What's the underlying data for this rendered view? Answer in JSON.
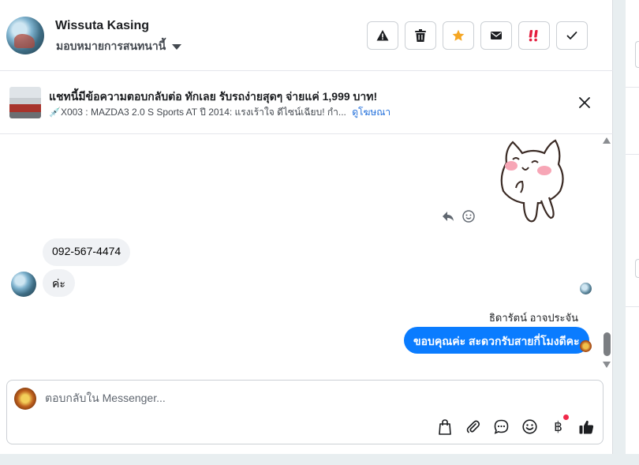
{
  "header": {
    "contact_name": "Wissuta Kasing",
    "assign_label": "มอบหมายการสนทนานี้"
  },
  "toolbar": {
    "buttons": [
      {
        "name": "report-spam-button",
        "icon": "warning-icon"
      },
      {
        "name": "delete-button",
        "icon": "trash-icon"
      },
      {
        "name": "star-button",
        "icon": "star-icon",
        "color": "#f5a623"
      },
      {
        "name": "mark-unread-button",
        "icon": "envelope-icon"
      },
      {
        "name": "follow-up-button",
        "icon": "exclamation-icon",
        "color": "#e41e3f"
      },
      {
        "name": "mark-done-button",
        "icon": "check-icon"
      }
    ]
  },
  "ad_banner": {
    "title": "แชทนี้มีข้อความตอบกลับต่อ ทักเลย รับรถง่ายสุดๆ จ่ายแค่ 1,999 บาท!",
    "subtitle": "💉X003 : MAZDA3 2.0 S Sports AT ปี 2014: แรงเร้าใจ ดีไซน์เฉียบ! กำ...",
    "link_label": "ดูโฆษณา"
  },
  "messages": [
    {
      "direction": "in",
      "text": "092-567-4474"
    },
    {
      "direction": "in",
      "text": "ค่ะ"
    },
    {
      "direction": "out",
      "sender": "ธิดารัตน์ อาจประจัน",
      "text": "ขอบคุณค่ะ สะดวกรับสายกี่โมงดีคะ"
    }
  ],
  "composer": {
    "placeholder": "ตอบกลับใน Messenger...",
    "tools": [
      "bag-icon",
      "paperclip-icon",
      "chat-bubble-icon",
      "emoji-icon",
      "baht-icon",
      "thumbs-up-icon"
    ],
    "baht_symbol": "฿"
  },
  "colors": {
    "accent": "#0a7cff",
    "link": "#216fdb",
    "alert": "#f02849"
  }
}
